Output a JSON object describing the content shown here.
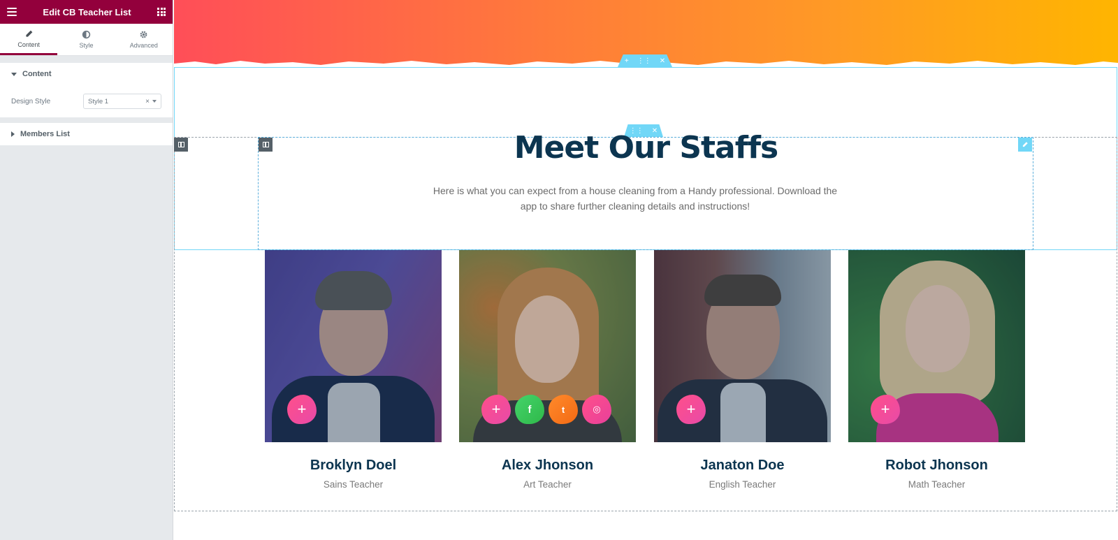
{
  "panel": {
    "title": "Edit CB Teacher List",
    "menu_icon": "hamburger-icon",
    "apps_icon": "grid-icon",
    "tabs": [
      {
        "label": "Content",
        "icon": "pencil-icon",
        "active": true
      },
      {
        "label": "Style",
        "icon": "half-circle-icon",
        "active": false
      },
      {
        "label": "Advanced",
        "icon": "gear-icon",
        "active": false
      }
    ],
    "content_section": {
      "title": "Content",
      "design_style_label": "Design Style",
      "design_style_value": "Style 1",
      "clear_glyph": "×"
    },
    "members_section": {
      "title": "Members List"
    },
    "collapse_glyph": "‹"
  },
  "handles": {
    "section_add": "+",
    "section_move": "⋮⋮",
    "section_close": "✕",
    "widget_move": "⋮⋮",
    "widget_close": "✕"
  },
  "heading": {
    "title": "Meet Our Staffs",
    "description": "Here is what you can expect from a house cleaning from a Handy professional. Download the app to share further cleaning details and instructions!"
  },
  "social_glyphs": {
    "plus": "+",
    "facebook": "f",
    "twitter": "t",
    "instagram": "◎"
  },
  "members": [
    {
      "name": "Broklyn Doel",
      "role": "Sains Teacher"
    },
    {
      "name": "Alex Jhonson",
      "role": "Art Teacher"
    },
    {
      "name": "Janaton Doe",
      "role": "English Teacher"
    },
    {
      "name": "Robot Jhonson",
      "role": "Math Teacher"
    }
  ],
  "colors": {
    "brand": "#93003c",
    "editor_accent": "#71d7f7",
    "heading": "#0c3550",
    "gradient_start": "#ff4e58",
    "gradient_end": "#ffb500"
  }
}
